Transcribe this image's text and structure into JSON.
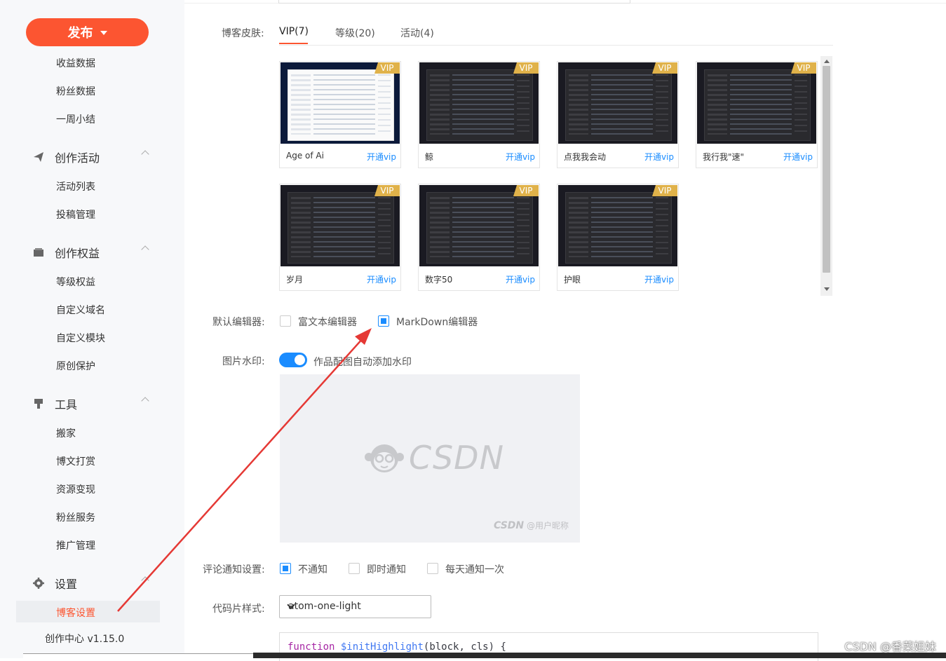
{
  "sidebar": {
    "publish_label": "发布",
    "items_top": [
      "收益数据",
      "粉丝数据",
      "一周小结"
    ],
    "groups": [
      {
        "title": "创作活动",
        "icon": "paper-plane-icon",
        "items": [
          "活动列表",
          "投稿管理"
        ]
      },
      {
        "title": "创作权益",
        "icon": "wallet-icon",
        "items": [
          "等级权益",
          "自定义域名",
          "自定义模块",
          "原创保护"
        ]
      },
      {
        "title": "工具",
        "icon": "brush-icon",
        "items": [
          "搬家",
          "博文打赏",
          "资源变现",
          "粉丝服务",
          "推广管理"
        ]
      },
      {
        "title": "设置",
        "icon": "gear-icon",
        "items": [
          "博客设置"
        ]
      }
    ],
    "active_item": "博客设置",
    "version": "创作中心 v1.15.0"
  },
  "form": {
    "skin_label": "博客皮肤:",
    "tabs": [
      "VIP(7)",
      "等级(20)",
      "活动(4)"
    ],
    "active_tab": "VIP(7)",
    "skins": [
      {
        "name": "Age of Ai",
        "badge": "VIP",
        "link": "开通vip",
        "theme": "light"
      },
      {
        "name": "鲸",
        "badge": "VIP",
        "link": "开通vip",
        "theme": "dark"
      },
      {
        "name": "点我我会动",
        "badge": "VIP",
        "link": "开通vip",
        "theme": "dark"
      },
      {
        "name": "我行我\"速\"",
        "badge": "VIP",
        "link": "开通vip",
        "theme": "dark"
      },
      {
        "name": "岁月",
        "badge": "VIP",
        "link": "开通vip",
        "theme": "dark"
      },
      {
        "name": "数字50",
        "badge": "VIP",
        "link": "开通vip",
        "theme": "dark"
      },
      {
        "name": "护眼",
        "badge": "VIP",
        "link": "开通vip",
        "theme": "dark"
      }
    ],
    "editor_label": "默认编辑器:",
    "editor_options": [
      {
        "label": "富文本编辑器",
        "checked": false
      },
      {
        "label": "MarkDown编辑器",
        "checked": true
      }
    ],
    "watermark_label": "图片水印:",
    "watermark_toggle_text": "作品配图自动添加水印",
    "watermark_on": true,
    "watermark_preview_logo": "CSDN",
    "watermark_preview_corner_brand": "CSDN",
    "watermark_preview_corner_user": "@用户昵称",
    "comment_label": "评论通知设置:",
    "comment_options": [
      {
        "label": "不通知",
        "checked": true
      },
      {
        "label": "即时通知",
        "checked": false
      },
      {
        "label": "每天通知一次",
        "checked": false
      }
    ],
    "code_style_label": "代码片样式:",
    "code_style_value": "atom-one-light",
    "code_preview": {
      "keyword": "function",
      "fn_name": "$initHighlight",
      "rest": "(block, cls) {"
    }
  },
  "page_watermark": "CSDN @香菜姐妹",
  "colors": {
    "brand": "#fc5531",
    "link": "#1a8cff",
    "vip": "#e0b24a",
    "annotation_arrow": "#e53935"
  }
}
